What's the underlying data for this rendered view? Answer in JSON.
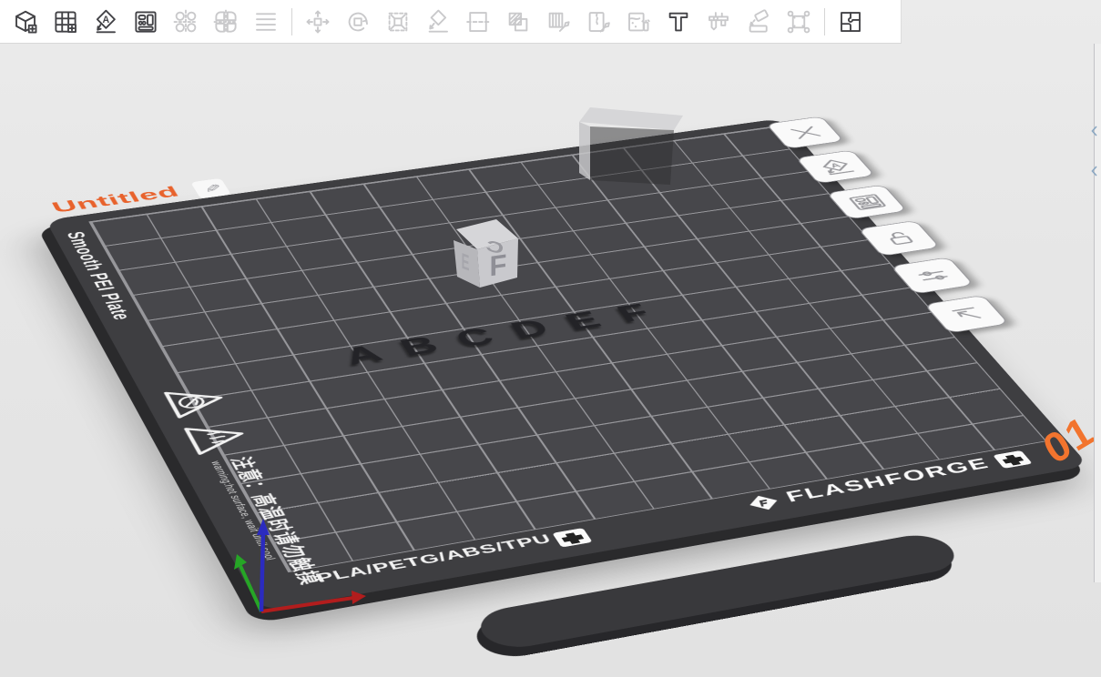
{
  "window": {
    "viewport_bg": "#e6e6e6",
    "toolbar_bg": "#ffffff"
  },
  "toolbar": {
    "groups": [
      {
        "name": "add",
        "items": [
          {
            "name": "add-model",
            "icon": "add-model-icon",
            "enabled": true
          },
          {
            "name": "add-plate",
            "icon": "add-plate-icon",
            "enabled": true
          },
          {
            "name": "auto-arrange",
            "icon": "auto-arrange-icon",
            "enabled": true
          },
          {
            "name": "auto-layout",
            "icon": "auto-layout-icon",
            "enabled": true
          }
        ]
      },
      {
        "name": "align",
        "items": [
          {
            "name": "align-objects",
            "icon": "align-circles-icon",
            "enabled": false
          },
          {
            "name": "align-plates",
            "icon": "align-plates-icon",
            "enabled": false
          },
          {
            "name": "distribute",
            "icon": "distribute-icon",
            "enabled": false
          }
        ]
      },
      {
        "name": "transform",
        "items": [
          {
            "name": "move",
            "icon": "move-icon",
            "enabled": false
          },
          {
            "name": "rotate",
            "icon": "rotate-icon",
            "enabled": false
          },
          {
            "name": "scale",
            "icon": "scale-icon",
            "enabled": false
          },
          {
            "name": "place-on-face",
            "icon": "place-on-face-icon",
            "enabled": false
          },
          {
            "name": "cut",
            "icon": "cut-icon",
            "enabled": false
          },
          {
            "name": "boolean",
            "icon": "boolean-icon",
            "enabled": false
          },
          {
            "name": "support-paint",
            "icon": "support-paint-icon",
            "enabled": false
          },
          {
            "name": "seam-paint",
            "icon": "seam-paint-icon",
            "enabled": false
          },
          {
            "name": "color-paint",
            "icon": "color-paint-icon",
            "enabled": false
          },
          {
            "name": "text-tool",
            "icon": "text-icon",
            "enabled": true
          },
          {
            "name": "measure",
            "icon": "measure-icon",
            "enabled": false
          },
          {
            "name": "emboss",
            "icon": "emboss-icon",
            "enabled": false
          },
          {
            "name": "fixture",
            "icon": "fixture-icon",
            "enabled": false
          }
        ]
      },
      {
        "name": "assembly",
        "items": [
          {
            "name": "assembly-view",
            "icon": "assembly-icon",
            "enabled": true
          }
        ]
      }
    ]
  },
  "plate": {
    "name": "Untitled",
    "number": "01",
    "type_label": "Smooth PEI Plate",
    "materials_label": "PLA/PETG/ABS/TPU",
    "brand": "FLASHFORGE",
    "warning_cn": "注意：高温时请勿触摸",
    "warning_en": "warning:hot surface, wait until cool",
    "letters": [
      "A",
      "B",
      "C",
      "D",
      "E",
      "F"
    ],
    "side_buttons": [
      {
        "name": "delete-plate",
        "icon": "close-icon"
      },
      {
        "name": "arrange-plate",
        "icon": "auto-arrange-icon"
      },
      {
        "name": "layout-plate",
        "icon": "auto-layout-icon"
      },
      {
        "name": "lock-plate",
        "icon": "lock-open-icon"
      },
      {
        "name": "plate-settings",
        "icon": "sliders-icon"
      },
      {
        "name": "move-plate-front",
        "icon": "arrow-up-left-icon"
      }
    ],
    "colors": {
      "surface": "#47474b",
      "rim": "#3e3e41",
      "grid_line": "#97979b",
      "name_orange": "#e8622c",
      "number_orange": "#f2742e"
    }
  },
  "objects": {
    "letter_cube": {
      "top_face": "C",
      "front_face": "F",
      "left_face": "E"
    }
  },
  "axes": {
    "x_color": "#b21d1d",
    "y_color": "#26a626",
    "z_color": "#2b2bbf"
  }
}
